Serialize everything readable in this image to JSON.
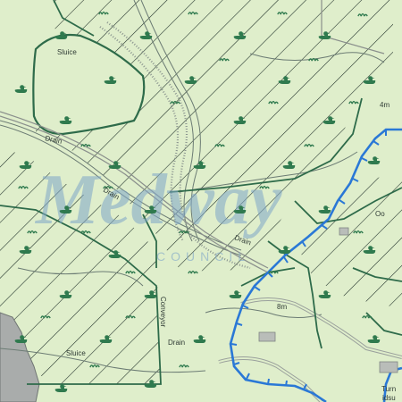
{
  "map": {
    "colors": {
      "background": "#dfeecb",
      "hatch": "#1a2a24",
      "boundary": "#2e6b4a",
      "ditch": "#6c7c74",
      "rail": "#8a8f8c",
      "blue_boundary": "#2a78d6",
      "duck_symbol": "#2f7a4e",
      "watermark": "#7ea6c9",
      "sea": "#a9acab"
    },
    "watermark": {
      "title": "Medway",
      "subtitle": "COUNCIL"
    },
    "symbols": {
      "marsh": "duck-icon",
      "grass": "grass-tuft-icon"
    },
    "labels": {
      "sluice_top": "Sluice",
      "drain_left": "Drain",
      "drain_mid": "Drain",
      "drain_right": "Drain",
      "drain_bottom": "Drain",
      "conveyor": "Conveyor",
      "sluice_bottom": "Sluice",
      "height_4m": "4m",
      "height_8m": "8m",
      "turn": "Turn",
      "idsu": "idsu",
      "oo": "Oo"
    }
  }
}
